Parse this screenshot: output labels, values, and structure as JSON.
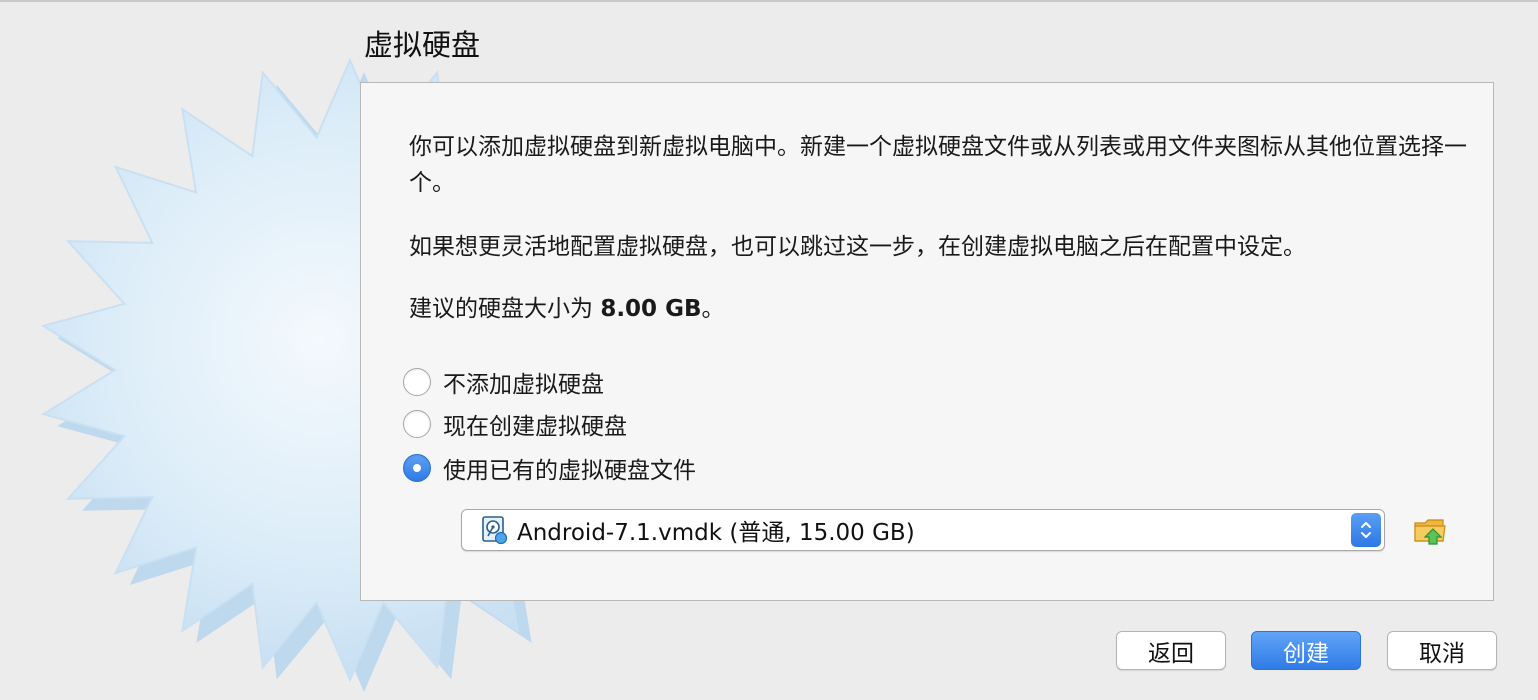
{
  "page": {
    "title": "虚拟硬盘"
  },
  "description": {
    "p1": "你可以添加虚拟硬盘到新虚拟电脑中。新建一个虚拟硬盘文件或从列表或用文件夹图标从其他位置选择一个。",
    "p2": "如果想更灵活地配置虚拟硬盘，也可以跳过这一步，在创建虚拟电脑之后在配置中设定。",
    "p3_prefix": "建议的硬盘大小为 ",
    "p3_size": "8.00 GB",
    "p3_suffix": "。"
  },
  "options": [
    {
      "label": "不添加虚拟硬盘",
      "checked": false
    },
    {
      "label": "现在创建虚拟硬盘",
      "checked": false
    },
    {
      "label": "使用已有的虚拟硬盘文件",
      "checked": true
    }
  ],
  "disk_select": {
    "value": "Android-7.1.vmdk (普通, 15.00 GB)",
    "icon": "hard-disk-icon"
  },
  "folder_button": {
    "icon": "folder-icon"
  },
  "buttons": {
    "back": "返回",
    "create": "创建",
    "cancel": "取消"
  },
  "colors": {
    "accent": "#2f7be6",
    "window_bg": "#ececec",
    "panel_bg": "#f6f6f6",
    "star_fill": "#dcecf8"
  }
}
